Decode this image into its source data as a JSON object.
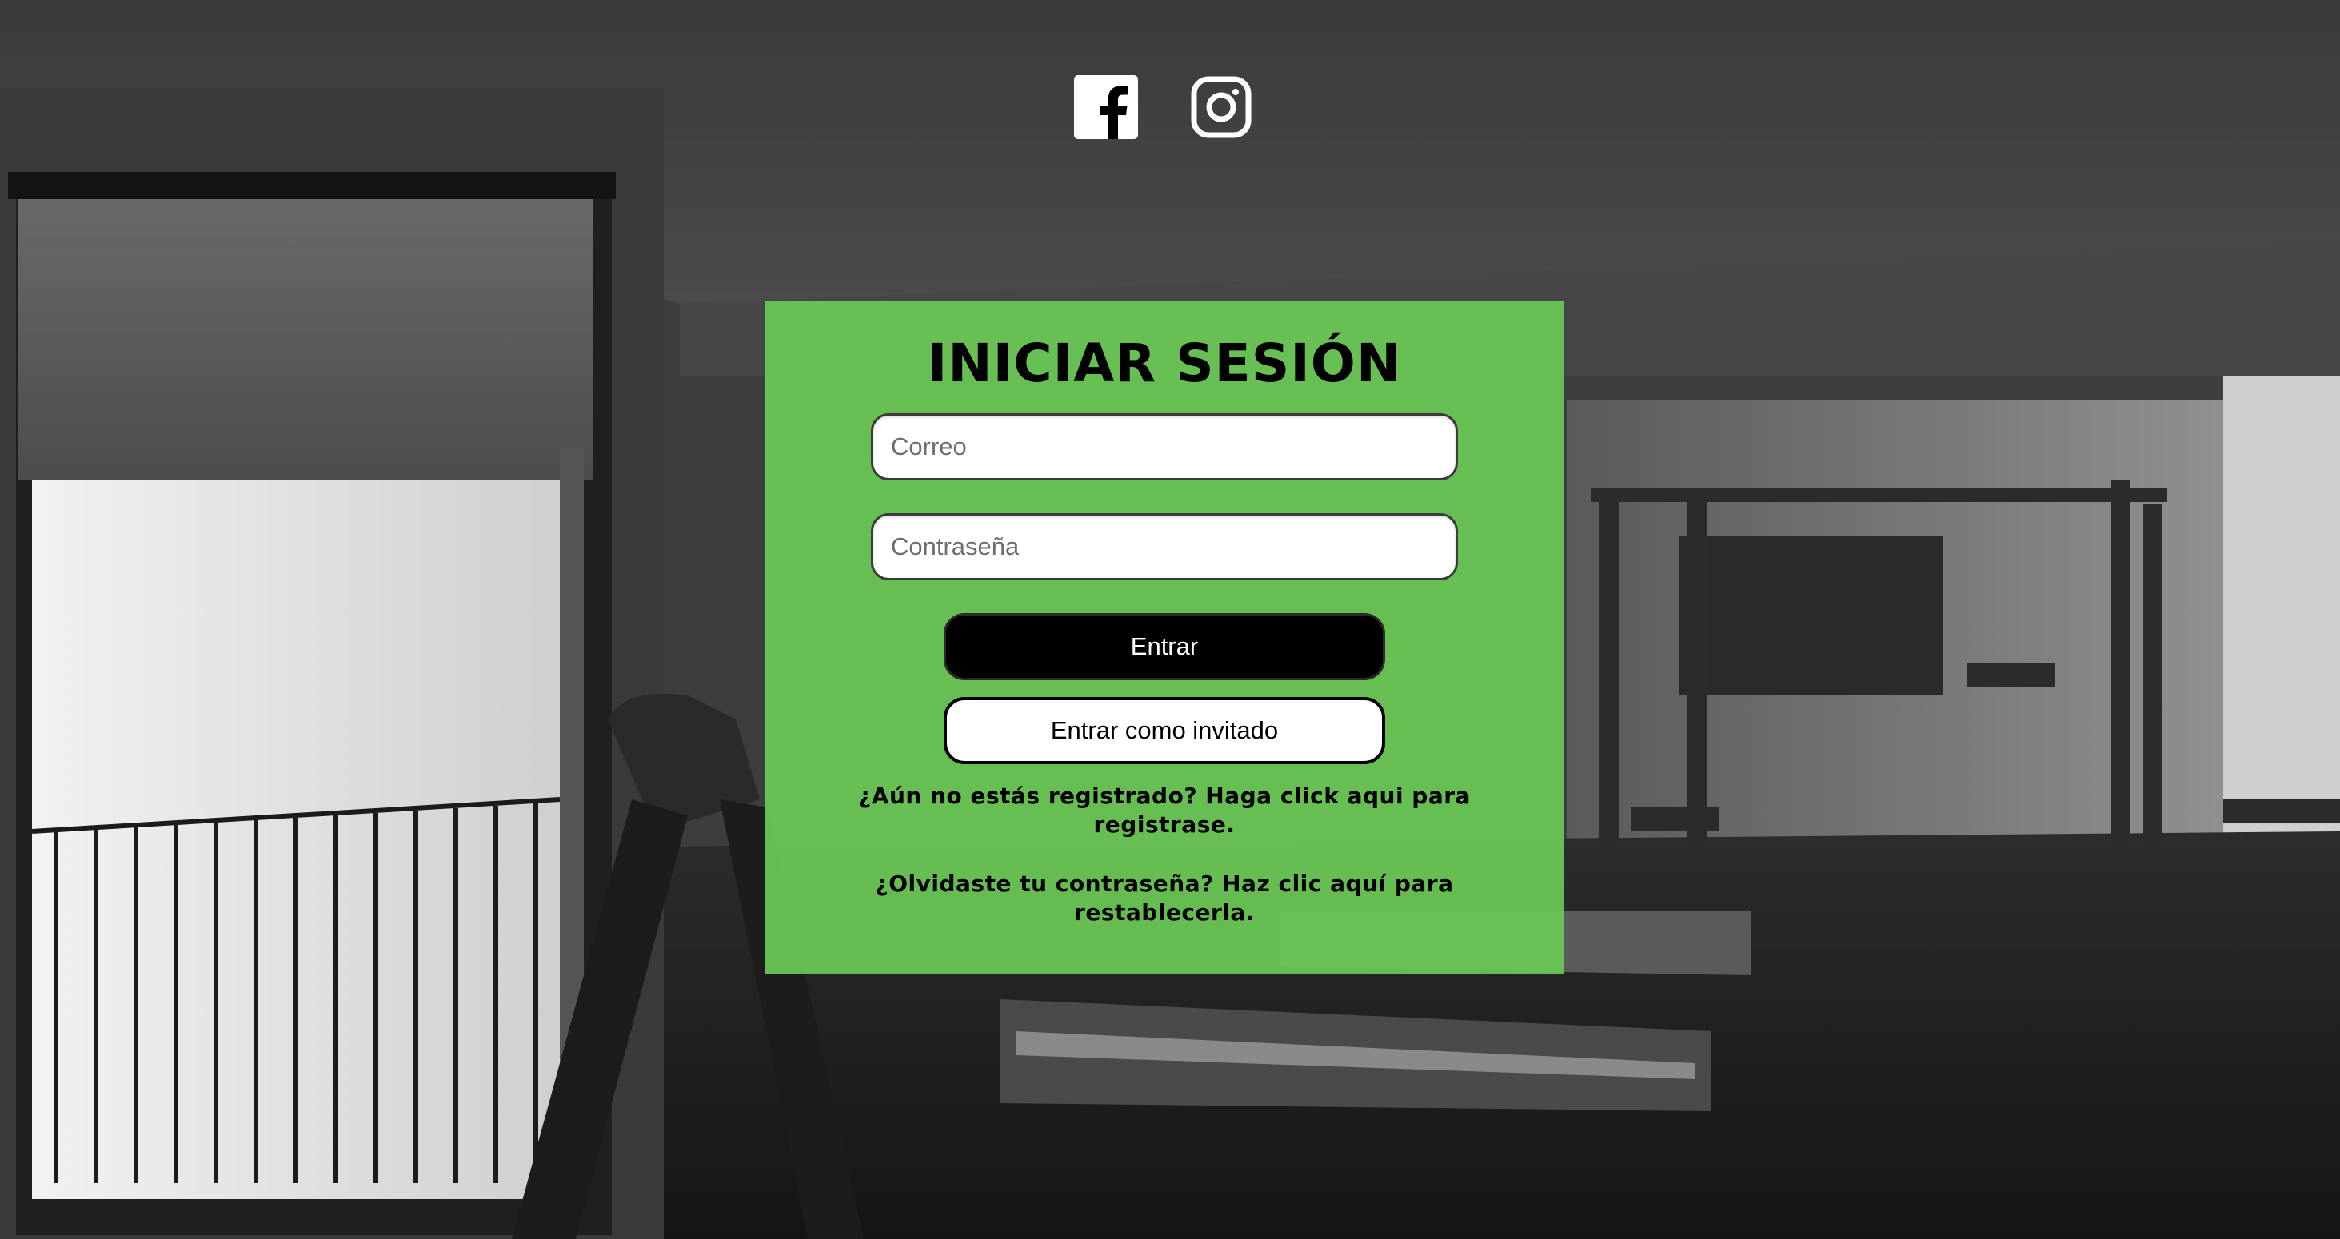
{
  "social": {
    "items": [
      {
        "name": "facebook-icon"
      },
      {
        "name": "instagram-icon"
      }
    ]
  },
  "login": {
    "title": "INICIAR SESIÓN",
    "email": {
      "placeholder": "Correo",
      "value": ""
    },
    "password": {
      "placeholder": "Contraseña",
      "value": ""
    },
    "submit_label": "Entrar",
    "guest_label": "Entrar como invitado",
    "register_text": "¿Aún no estás registrado? Haga click aqui para registrase.",
    "forgot_text": "¿Olvidaste tu contraseña? Haz clic aquí para restablecerla."
  },
  "colors": {
    "panel": "#6ac854",
    "button_primary": "#000000",
    "button_secondary": "#ffffff"
  }
}
